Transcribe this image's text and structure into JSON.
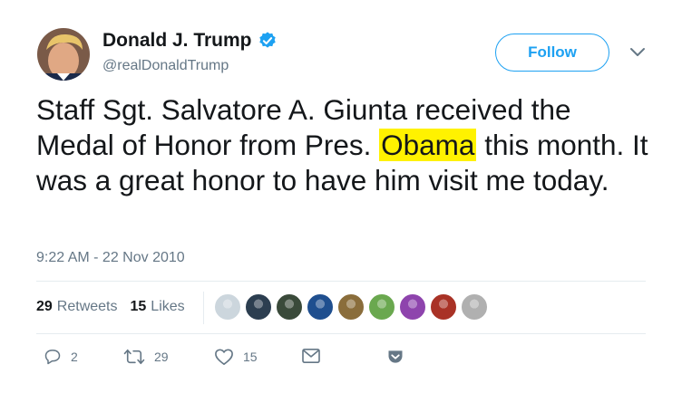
{
  "header": {
    "display_name": "Donald J. Trump",
    "handle": "@realDonaldTrump",
    "follow_label": "Follow",
    "verified_icon": "verified-badge-icon",
    "menu_icon": "chevron-down-icon"
  },
  "tweet": {
    "text_before": "Staff Sgt. Salvatore A. Giunta received the Medal of Honor from Pres. ",
    "highlight": "Obama",
    "text_after": " this month. It was a great honor to have him visit me today.",
    "timestamp": "9:22 AM - 22 Nov 2010"
  },
  "stats": {
    "retweets_count": "29",
    "retweets_label": "Retweets",
    "likes_count": "15",
    "likes_label": "Likes",
    "likers": [
      {
        "name": "liker-avatar-1",
        "color": "#ccd6dd"
      },
      {
        "name": "liker-avatar-2",
        "color": "#2c3e50"
      },
      {
        "name": "liker-avatar-3",
        "color": "#3a4a3a"
      },
      {
        "name": "liker-avatar-4",
        "color": "#1f4f8f"
      },
      {
        "name": "liker-avatar-5",
        "color": "#8a6d3b"
      },
      {
        "name": "liker-avatar-6",
        "color": "#6aa84f"
      },
      {
        "name": "liker-avatar-7",
        "color": "#8e44ad"
      },
      {
        "name": "liker-avatar-8",
        "color": "#a93226"
      },
      {
        "name": "liker-avatar-9",
        "color": "#b0b0b0"
      }
    ]
  },
  "actions": {
    "reply_count": "2",
    "retweet_count": "29",
    "like_count": "15"
  },
  "colors": {
    "accent": "#1da1f2",
    "highlight": "#fff200",
    "muted": "#657786",
    "text": "#14171a"
  }
}
